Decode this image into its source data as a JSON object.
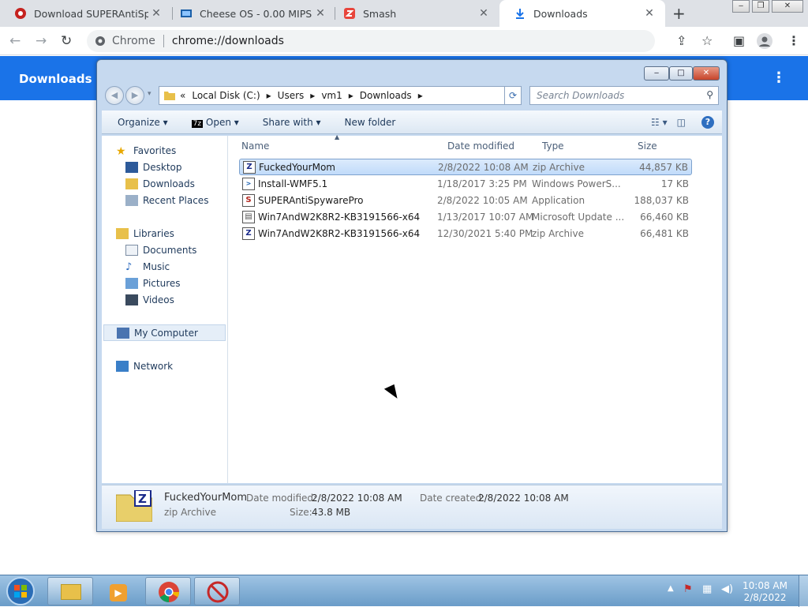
{
  "tabs": [
    {
      "title": "Download SUPERAntiSpyw",
      "color": "#d93025",
      "icon": "superantispyware-icon"
    },
    {
      "title": "Cheese OS - 0.00 MIPS",
      "color": "#1a73e8",
      "icon": "monitor-icon"
    },
    {
      "title": "Smash",
      "color": "#e8453c",
      "icon": "smash-icon"
    },
    {
      "title": "Downloads",
      "color": "#1a73e8",
      "icon": "download-icon"
    }
  ],
  "omnibox": {
    "chip": "Chrome",
    "url": "chrome://downloads"
  },
  "downloads_page": {
    "title": "Downloads"
  },
  "explorer": {
    "breadcrumb": [
      "«",
      "Local Disk (C:)",
      "Users",
      "vm1",
      "Downloads"
    ],
    "search_placeholder": "Search Downloads",
    "commands": [
      "Organize",
      "Open",
      "Share with",
      "New folder"
    ],
    "nav": {
      "favorites": "Favorites",
      "desktop": "Desktop",
      "downloads": "Downloads",
      "recent": "Recent Places",
      "libraries": "Libraries",
      "documents": "Documents",
      "music": "Music",
      "pictures": "Pictures",
      "videos": "Videos",
      "computer": "My Computer",
      "network": "Network"
    },
    "columns": [
      "Name",
      "Date modified",
      "Type",
      "Size"
    ],
    "files": [
      {
        "name": "FuckedYourMom",
        "date": "2/8/2022 10:08 AM",
        "type": "zip Archive",
        "size": "44,857 KB"
      },
      {
        "name": "Install-WMF5.1",
        "date": "1/18/2017 3:25 PM",
        "type": "Windows PowerS...",
        "size": "17 KB"
      },
      {
        "name": "SUPERAntiSpywarePro",
        "date": "2/8/2022 10:05 AM",
        "type": "Application",
        "size": "188,037 KB"
      },
      {
        "name": "Win7AndW2K8R2-KB3191566-x64",
        "date": "1/13/2017 10:07 AM",
        "type": "Microsoft Update ...",
        "size": "66,460 KB"
      },
      {
        "name": "Win7AndW2K8R2-KB3191566-x64",
        "date": "12/30/2021 5:40 PM",
        "type": "zip Archive",
        "size": "66,481 KB"
      }
    ],
    "details": {
      "name": "FuckedYourMom",
      "type": "zip Archive",
      "modified_label": "Date modified:",
      "modified": "2/8/2022 10:08 AM",
      "created_label": "Date created:",
      "created": "2/8/2022 10:08 AM",
      "size_label": "Size:",
      "size": "43.8 MB"
    }
  },
  "clock": {
    "time": "10:08 AM",
    "date": "2/8/2022"
  }
}
